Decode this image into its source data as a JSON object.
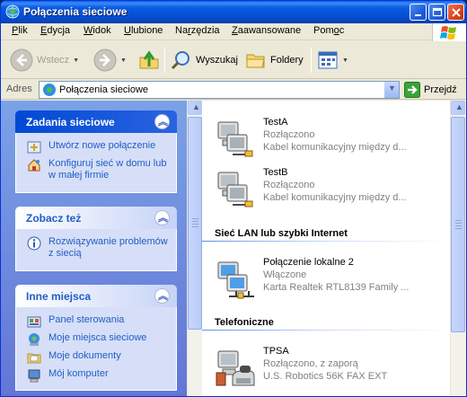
{
  "window": {
    "title": "Połączenia sieciowe"
  },
  "menu": {
    "items": [
      {
        "before": "",
        "u": "P",
        "after": "lik"
      },
      {
        "before": "",
        "u": "E",
        "after": "dycja"
      },
      {
        "before": "",
        "u": "W",
        "after": "idok"
      },
      {
        "before": "",
        "u": "U",
        "after": "lubione"
      },
      {
        "before": "Na",
        "u": "r",
        "after": "zędzia"
      },
      {
        "before": "",
        "u": "Z",
        "after": "aawansowane"
      },
      {
        "before": "Pom",
        "u": "o",
        "after": "c"
      }
    ]
  },
  "toolbar": {
    "back_label": "Wstecz",
    "search_label": "Wyszukaj",
    "folders_label": "Foldery"
  },
  "address": {
    "label": "Adres",
    "value": "Połączenia sieciowe",
    "go_label": "Przejdź"
  },
  "taskpane": {
    "panels": [
      {
        "title": "Zadania sieciowe",
        "tasks": [
          {
            "label": "Utwórz nowe połączenie",
            "icon": "new-connection-icon"
          },
          {
            "label": "Konfiguruj sieć w domu lub w małej firmie",
            "icon": "home-network-icon"
          }
        ]
      },
      {
        "title": "Zobacz też",
        "tasks": [
          {
            "label": "Rozwiązywanie problemów z siecią",
            "icon": "info-icon"
          }
        ]
      },
      {
        "title": "Inne miejsca",
        "tasks": [
          {
            "label": "Panel sterowania",
            "icon": "control-panel-icon"
          },
          {
            "label": "Moje miejsca sieciowe",
            "icon": "network-places-icon"
          },
          {
            "label": "Moje dokumenty",
            "icon": "documents-folder-icon"
          },
          {
            "label": "Mój komputer",
            "icon": "my-computer-icon"
          }
        ]
      }
    ]
  },
  "content": {
    "groups": [
      {
        "title": "",
        "items": [
          {
            "name": "TestA",
            "status": "Rozłączono",
            "device": "Kabel komunikacyjny między d...",
            "type": "cable-connection-icon"
          },
          {
            "name": "TestB",
            "status": "Rozłączono",
            "device": "Kabel komunikacyjny między d...",
            "type": "cable-connection-icon"
          }
        ]
      },
      {
        "title": "Sieć LAN lub szybki Internet",
        "items": [
          {
            "name": "Połączenie lokalne 2",
            "status": "Włączone",
            "device": "Karta Realtek RTL8139 Family ...",
            "type": "lan-connection-icon"
          }
        ]
      },
      {
        "title": "Telefoniczne",
        "items": [
          {
            "name": "TPSA",
            "status": "Rozłączono, z zaporą",
            "device": "U.S. Robotics 56K FAX EXT",
            "type": "dialup-connection-icon"
          }
        ]
      }
    ]
  },
  "colors": {
    "titlebar": "#0551d6",
    "taskpane_link": "#215dc6",
    "taskpane_bg": "#6375d6",
    "panel_body": "#d6dff7"
  }
}
